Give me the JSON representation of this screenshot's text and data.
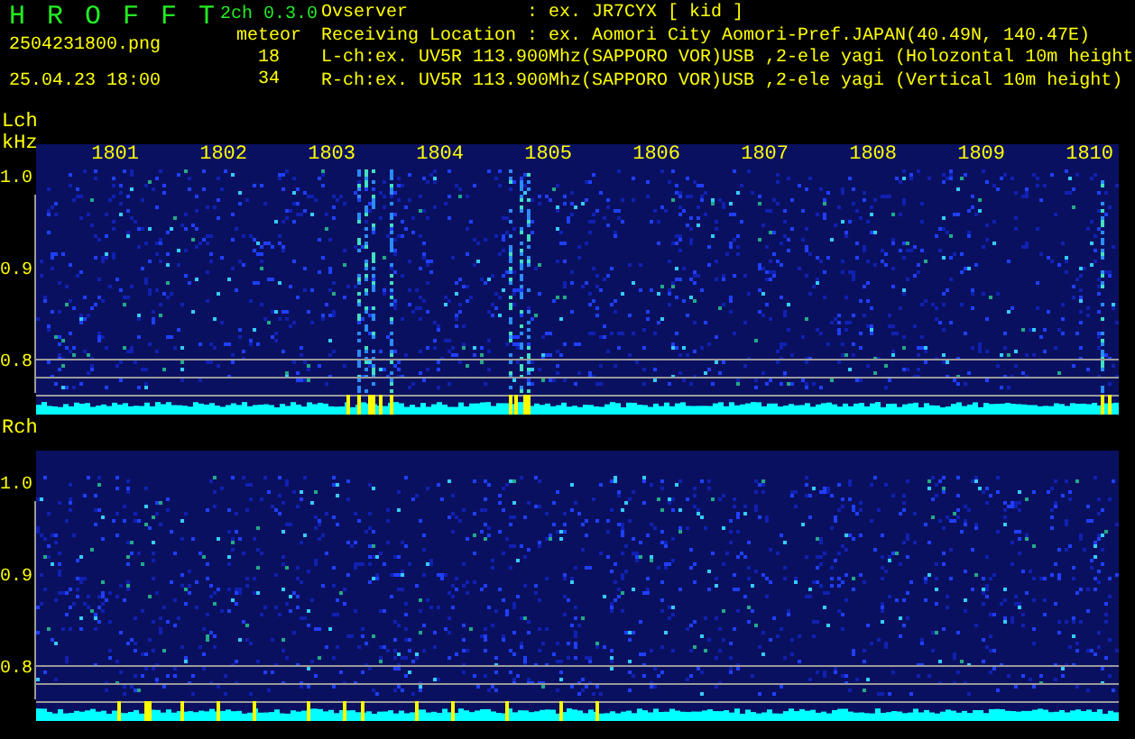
{
  "header": {
    "title": "H R O F F T",
    "version": "2ch 0.3.0",
    "filename": "2504231800.png",
    "datetime": "25.04.23 18:00",
    "meteor_label": "meteor",
    "counts": [
      "18",
      "34"
    ],
    "info": [
      {
        "label": "Ovserver",
        "value": ": ex. JR7CYX [ kid ]"
      },
      {
        "label": "Receiving Location",
        "value": ": ex. Aomori City Aomori-Pref.JAPAN(40.49N, 140.47E)"
      },
      {
        "label": "L-ch:ex. UV5R 113.900Mhz(SAPPORO VOR)USB ,2-ele yagi (Holozontal 10m height"
      },
      {
        "label": "R-ch:ex. UV5R 113.900Mhz(SAPPORO VOR)USB ,2-ele yagi (Vertical 10m height)"
      }
    ]
  },
  "panels": [
    {
      "channel": "Lch",
      "unit": "kHz",
      "time_labels": [
        "1801",
        "1802",
        "1803",
        "1804",
        "1805",
        "1806",
        "1807",
        "1808",
        "1809",
        "1810"
      ],
      "freq_labels": [
        "1.0",
        "0.9",
        "0.8"
      ]
    },
    {
      "channel": "Rch",
      "freq_labels": [
        "1.0",
        "0.9",
        "0.8"
      ]
    }
  ]
}
